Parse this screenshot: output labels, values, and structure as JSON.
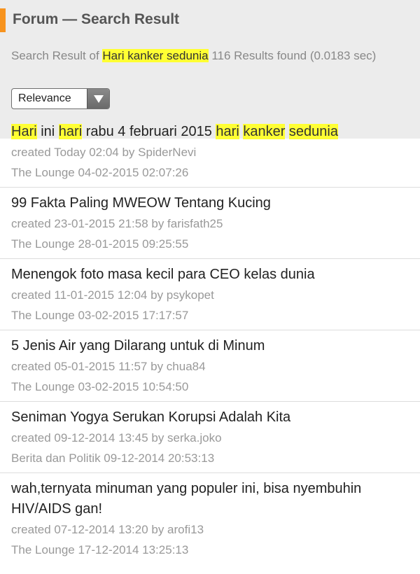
{
  "header": {
    "title": "Forum — Search Result"
  },
  "search": {
    "prefix": "Search Result of ",
    "query": "Hari kanker sedunia",
    "suffix": " 116 Results found (0.0183 sec)"
  },
  "sort": {
    "selected": "Relevance"
  },
  "results": [
    {
      "title_parts": [
        "Hari",
        " ini ",
        "hari",
        " rabu 4 februari 2015 ",
        "hari",
        " ",
        "kanker",
        " ",
        "sedunia"
      ],
      "created": "created Today 02:04 by SpiderNevi",
      "forum_line": "The Lounge 04-02-2015 02:07:26"
    },
    {
      "title": "99 Fakta Paling MWEOW Tentang Kucing",
      "created": "created 23-01-2015 21:58 by farisfath25",
      "forum_line": "The Lounge 28-01-2015 09:25:55"
    },
    {
      "title": "Menengok foto masa kecil para CEO kelas dunia",
      "created": "created 11-01-2015 12:04 by psykopet",
      "forum_line": "The Lounge 03-02-2015 17:17:57"
    },
    {
      "title": "5 Jenis Air yang Dilarang untuk di Minum",
      "created": "created 05-01-2015 11:57 by chua84",
      "forum_line": "The Lounge 03-02-2015 10:54:50"
    },
    {
      "title": "Seniman Yogya Serukan Korupsi Adalah Kita",
      "created": "created 09-12-2014 13:45 by serka.joko",
      "forum_line": "Berita dan Politik 09-12-2014 20:53:13"
    },
    {
      "title": "wah,ternyata minuman yang populer ini, bisa nyembuhin HIV/AIDS gan!",
      "created": "created 07-12-2014 13:20 by arofi13",
      "forum_line": "The Lounge 17-12-2014 13:25:13"
    }
  ],
  "colors": {
    "accent": "#f7931e",
    "highlight": "#ffff33",
    "header_bg": "#ececec"
  }
}
